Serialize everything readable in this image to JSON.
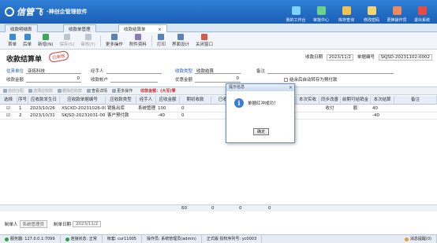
{
  "app": {
    "logo_text": "信管飞",
    "logo_sub": "·神创企管理软件"
  },
  "top_actions": [
    {
      "label": "我的工作台",
      "icon": "workbench-icon",
      "color": "#7fd1ff"
    },
    {
      "label": "审批中心",
      "icon": "approval-icon",
      "color": "#6ed18a"
    },
    {
      "label": "库存查询",
      "icon": "inventory-icon",
      "color": "#f2c14e"
    },
    {
      "label": "修改密码",
      "icon": "lock-icon",
      "color": "#f5d76e"
    },
    {
      "label": "更换操作员",
      "icon": "switch-user-icon",
      "color": "#f08a5d"
    },
    {
      "label": "退出系统",
      "icon": "exit-icon",
      "color": "#e74c3c"
    }
  ],
  "doc_tabs": [
    {
      "label": "收款明细表",
      "active": false
    },
    {
      "label": "收款单管理",
      "active": false
    },
    {
      "label": "收款结算单",
      "active": true,
      "close": "×"
    }
  ],
  "toolbar": [
    {
      "label": "首单",
      "icon": "first-icon",
      "disabled": false
    },
    {
      "label": "后单",
      "icon": "next-icon",
      "disabled": false
    },
    {
      "label": "新增(N)",
      "icon": "add-icon",
      "disabled": false
    },
    {
      "label": "保存(S)",
      "icon": "save-icon",
      "disabled": true
    },
    {
      "label": "审核(Y)",
      "icon": "audit-icon",
      "disabled": true
    },
    {
      "label": "更多操作",
      "icon": "more-icon",
      "disabled": false
    },
    {
      "label": "附件资料",
      "icon": "attachment-icon",
      "disabled": false
    },
    {
      "label": "打印",
      "icon": "print-icon",
      "disabled": false
    },
    {
      "label": "界面设计",
      "icon": "design-icon",
      "disabled": false
    },
    {
      "label": "关闭窗口",
      "icon": "close-window-icon",
      "disabled": false
    }
  ],
  "form": {
    "title": "收款结算单",
    "stamp": "已审核",
    "date_label": "收款日期",
    "date_value": "2023/11/2",
    "no_label": "单据编号",
    "no_value": "SKJSD-20231102-0002",
    "customer_label": "往来单位",
    "customer_value": "亚拓科技",
    "handler_label": "经手人",
    "handler_value": "",
    "type_label": "收款类型",
    "type_value": "收款结算",
    "remark_label": "备注",
    "remark_value": "",
    "amount_label": "收款金额",
    "amount_value": "0",
    "account_label": "收款帐户",
    "account_value": "",
    "discount_label": "优惠金额",
    "discount_value": "0",
    "auto_check_label": "结余后自动转存为预付款"
  },
  "sub_toolbar": [
    {
      "label": "自动分配",
      "on": false
    },
    {
      "label": "选择应收款",
      "on": false
    },
    {
      "label": "删除应收款",
      "on": false
    },
    {
      "label": "查看详情",
      "on": true
    },
    {
      "label": "更多操作",
      "on": true
    }
  ],
  "sub_toolbar_note": "收款金额：(大写)零",
  "grid": {
    "headers": [
      "选择",
      "序号",
      "应收款发生日",
      "应收款单据编号",
      "应收款类型",
      "经手人",
      "应收金额",
      "期初收款",
      "已收款",
      "未收款",
      "本次收款",
      "本次实收",
      "同步改善收付",
      "前期可结销金额",
      "本次结算",
      "备注"
    ],
    "rows": [
      {
        "checked": true,
        "seq": "1",
        "date": "2023/10/26",
        "doc_no": "XSCKD-20231026-00",
        "type": "销售出库",
        "handler": "系统管理",
        "amount": "100",
        "prior": "0",
        "settle": "40"
      },
      {
        "checked": true,
        "seq": "2",
        "date": "2023/10/31",
        "doc_no": "SKJSD-20231031-00",
        "type": "客户预付款",
        "handler": "",
        "amount": "-40",
        "prior": "0",
        "settle": "-40"
      }
    ],
    "footer": {
      "sum1": "60",
      "sum2": "0",
      "sum3": "0",
      "sum4": "0"
    }
  },
  "bottom": {
    "creator_label": "制单人",
    "creator_value": "系统管理员",
    "date_label": "制单日期",
    "date_value": "2023/11/2"
  },
  "statusbar": [
    {
      "label": "服务器: 127.0.0.1:7099",
      "dot": "#2e9e48"
    },
    {
      "label": "连接状态: 正常",
      "dot": "#2e9e48"
    },
    {
      "label": "帐套: cur11005",
      "dot": ""
    },
    {
      "label": "操作员: 系统管理员(admin)",
      "dot": ""
    },
    {
      "label": "正式版  授权序列号: yc0003",
      "dot": ""
    },
    {
      "label": "消息提醒(0)",
      "dot": "#e0a030"
    }
  ],
  "dialog": {
    "title": "提示信息",
    "close": "×",
    "icon_char": "i",
    "message": "单据红冲成功！",
    "ok_label": "确定"
  }
}
